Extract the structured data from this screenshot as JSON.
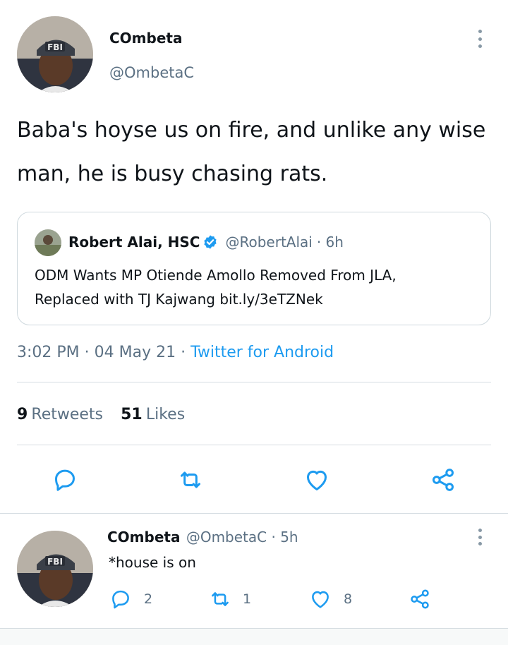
{
  "tweet": {
    "display_name": "COmbeta",
    "handle": "@OmbetaC",
    "text_line1": "Baba's hoyse us on fire, and unlike any wise",
    "text_line2": "man, he is busy chasing rats.",
    "quote": {
      "display_name": "Robert Alai, HSC",
      "handle": "@RobertAlai",
      "time": "· 6h",
      "text_line1": "ODM Wants MP Otiende Amollo Removed From JLA,",
      "text_line2": "Replaced with TJ Kajwang bit.ly/3eTZNek"
    },
    "timestamp": "3:02 PM · 04 May 21 · ",
    "source": "Twitter for Android",
    "retweets_count": "9",
    "retweets_label": "Retweets",
    "likes_count": "51",
    "likes_label": "Likes"
  },
  "reply": {
    "display_name": "COmbeta",
    "handle": "@OmbetaC",
    "time": "· 5h",
    "text": "*house is on",
    "reply_count": "2",
    "retweet_count": "1",
    "like_count": "8"
  },
  "icons": {
    "more": "more-vertical-icon",
    "verified": "verified-badge-icon",
    "reply": "reply-icon",
    "retweet": "retweet-icon",
    "like": "heart-icon",
    "share": "share-icon"
  },
  "colors": {
    "accent": "#1d9bf0",
    "muted": "#5b7083",
    "icon": "#1d9bf0"
  }
}
